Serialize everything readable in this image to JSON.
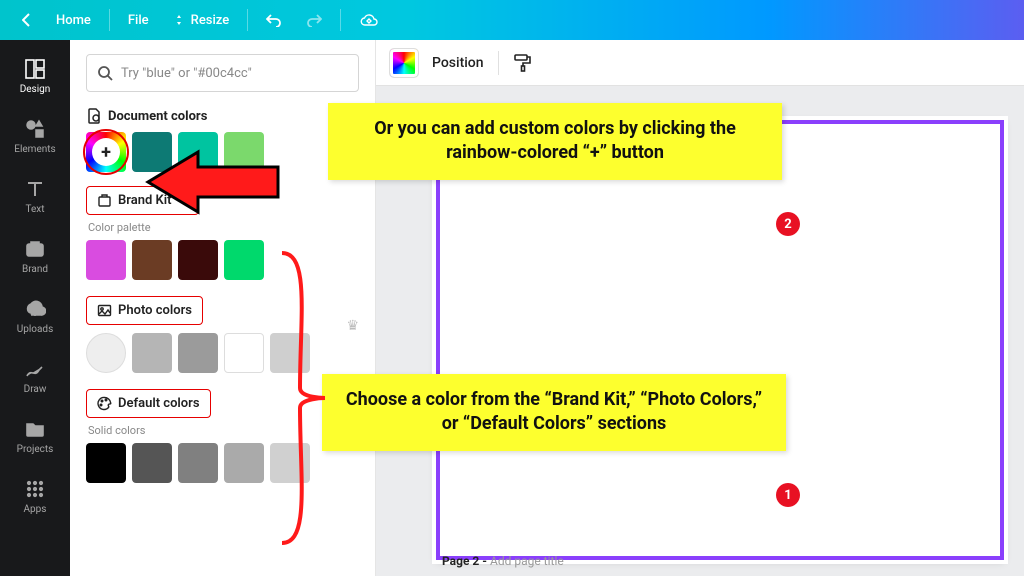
{
  "topbar": {
    "home": "Home",
    "file": "File",
    "resize": "Resize"
  },
  "rail": {
    "design": "Design",
    "elements": "Elements",
    "text": "Text",
    "brand": "Brand",
    "uploads": "Uploads",
    "draw": "Draw",
    "projects": "Projects",
    "apps": "Apps"
  },
  "panel": {
    "search_placeholder": "Try \"blue\" or \"#00c4cc\"",
    "document_colors": "Document colors",
    "brand_kit": "Brand Kit",
    "color_palette": "Color palette",
    "photo_colors": "Photo colors",
    "default_colors": "Default colors",
    "solid_colors": "Solid colors",
    "doc_swatches": [
      "#0d7a74",
      "#00c4a0",
      "#7bd96c"
    ],
    "palette_swatches": [
      "#d94ce0",
      "#6b3c24",
      "#3a0a0a",
      "#00d96c"
    ],
    "photo_swatches": [
      "#eeeeee",
      "#b5b5b5",
      "#9b9b9b",
      "#ffffff",
      "#cfcfcf"
    ],
    "solid_swatches": [
      "#000000",
      "#555555",
      "#808080",
      "#aaaaaa",
      "#d0d0d0"
    ]
  },
  "context": {
    "position": "Position"
  },
  "page": {
    "prefix": "Page 2 -",
    "title": "Add page title"
  },
  "annotations": {
    "c1": "Choose a color from the “Brand Kit,” “Photo Colors,” or “Default Colors” sections",
    "c2": "Or you can add custom colors by clicking the rainbow-colored “+” button",
    "b1": "1",
    "b2": "2"
  }
}
